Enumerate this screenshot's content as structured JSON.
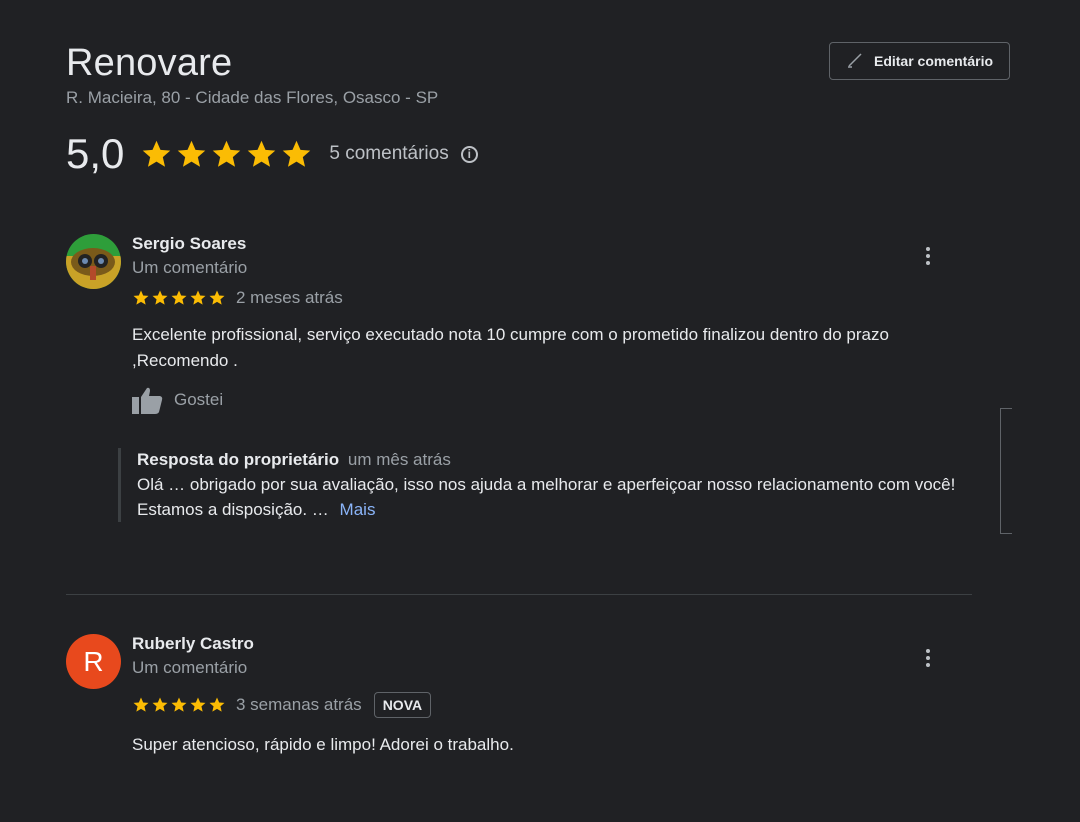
{
  "business": {
    "name": "Renovare",
    "address": "R. Macieira, 80 - Cidade das Flores, Osasco - SP",
    "edit_button": "Editar comentário"
  },
  "rating": {
    "value": "5,0",
    "stars": 5,
    "count_label": "5 comentários",
    "star_color": "#fbbc04"
  },
  "reviews": [
    {
      "name": "Sergio Soares",
      "meta": "Um comentário",
      "stars": 5,
      "time": "2 meses atrás",
      "text": "Excelente profissional, serviço executado nota 10 cumpre com o prometido finalizou dentro do prazo ,Recomendo .",
      "like_label": "Gostei",
      "owner_reply": {
        "label": "Resposta do proprietário",
        "time": "um mês atrás",
        "text_line1": "Olá … obrigado por sua avaliação, isso nos ajuda a melhorar e aperfeiçoar nosso relacionamento com você!",
        "text_line2": "Estamos a disposição. …",
        "more": "Mais"
      }
    },
    {
      "name": "Ruberly Castro",
      "avatar_letter": "R",
      "avatar_color": "#e8491d",
      "meta": "Um comentário",
      "stars": 5,
      "time": "3 semanas atrás",
      "badge": "NOVA",
      "text": "Super atencioso, rápido e  limpo! Adorei o trabalho."
    }
  ]
}
